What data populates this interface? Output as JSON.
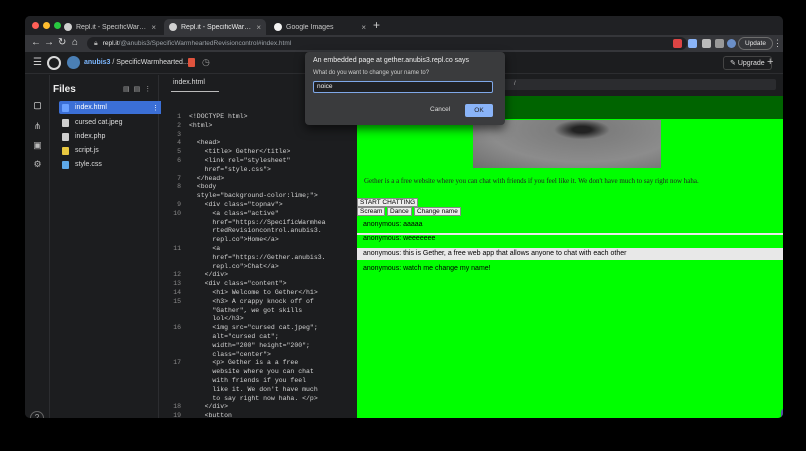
{
  "browser": {
    "tabs": [
      {
        "title": "Repl.it - SpecificWarmhearted",
        "close": "×"
      },
      {
        "title": "Repl.it - SpecificWarmhearted",
        "close": "×"
      },
      {
        "title": "Google Images",
        "close": "×"
      }
    ],
    "new_tab": "+",
    "url_host": "repl.it",
    "url_path": "/@anubis3/SpecificWarmheartedRevisioncontrol#index.html",
    "update_label": "Update"
  },
  "replit": {
    "user": "anubis3",
    "separator": " / ",
    "project": "SpecificWarmhearted...",
    "upgrade_label": "Upgrade",
    "plus": "+"
  },
  "files": {
    "title": "Files",
    "items": [
      {
        "name": "index.html",
        "icon": "html-file-icon",
        "color": "#6aa0ff"
      },
      {
        "name": "cursed cat.jpeg",
        "icon": "file-icon",
        "color": "#cfcfcf"
      },
      {
        "name": "index.php",
        "icon": "file-icon",
        "color": "#cfcfcf"
      },
      {
        "name": "script.js",
        "icon": "js-file-icon",
        "color": "#e8c840"
      },
      {
        "name": "style.css",
        "icon": "css-file-icon",
        "color": "#5ea8e8"
      }
    ],
    "help": "?"
  },
  "editor": {
    "tab": "index.html",
    "lines": [
      {
        "n": "1",
        "text": "<!DOCTYPE html>"
      },
      {
        "n": "2",
        "text": "<html>"
      },
      {
        "n": "3",
        "text": ""
      },
      {
        "n": "4",
        "text": "  <head>"
      },
      {
        "n": "5",
        "text": "    <title> Gether</title>"
      },
      {
        "n": "6",
        "text": "    <link rel=\"stylesheet\""
      },
      {
        "n": "",
        "text": "    href=\"style.css\">"
      },
      {
        "n": "7",
        "text": "  </head>"
      },
      {
        "n": "8",
        "text": "  <body"
      },
      {
        "n": "",
        "text": "  style=\"background-color:lime;\">"
      },
      {
        "n": "9",
        "text": "    <div class=\"topnav\">"
      },
      {
        "n": "10",
        "text": "      <a class=\"active\""
      },
      {
        "n": "",
        "text": "      href=\"https://SpecificWarmhea"
      },
      {
        "n": "",
        "text": "      rtedRevisioncontrol.anubis3."
      },
      {
        "n": "",
        "text": "      repl.co\">Home</a>"
      },
      {
        "n": "11",
        "text": "      <a"
      },
      {
        "n": "",
        "text": "      href=\"https://Gether.anubis3."
      },
      {
        "n": "",
        "text": "      repl.co\">Chat</a>"
      },
      {
        "n": "12",
        "text": "    </div>"
      },
      {
        "n": "13",
        "text": "    <div class=\"content\">"
      },
      {
        "n": "14",
        "text": "      <h1> Welcome to Gether</h1>"
      },
      {
        "n": "15",
        "text": "      <h3> A crappy knock off of"
      },
      {
        "n": "",
        "text": "      \"Gather\", we got skills"
      },
      {
        "n": "",
        "text": "      lol</h3>"
      },
      {
        "n": "16",
        "text": "      <img src=\"cursed cat.jpeg\";"
      },
      {
        "n": "",
        "text": "      alt=\"cursed cat\";"
      },
      {
        "n": "",
        "text": "      width=\"200\" height=\"200\";"
      },
      {
        "n": "",
        "text": "      class=\"center\">"
      },
      {
        "n": "17",
        "text": "      <p> Gether is a a free"
      },
      {
        "n": "",
        "text": "      website where you can chat"
      },
      {
        "n": "",
        "text": "      with friends if you feel"
      },
      {
        "n": "",
        "text": "      like it. We don't have much"
      },
      {
        "n": "",
        "text": "      to say right now haha. </p>"
      },
      {
        "n": "18",
        "text": "    </div>"
      },
      {
        "n": "19",
        "text": "    <button"
      }
    ]
  },
  "preview": {
    "url_fragment": "/",
    "blurb": "Gether is a a free website where you can chat with friends if you feel like it. We don't have much to say right now haha.",
    "start_button": "START CHATTING",
    "buttons": [
      "Scream",
      "Dance",
      "Change name"
    ],
    "messages": [
      "anonymous: aaaaa",
      "anonymous: weeeeeee",
      "anonymous: this is Gether, a free web app that allows anyone to chat with each other",
      "anonymous: watch me change my name!"
    ],
    "page_bg": "#00ff00",
    "nav_bg": "#006400"
  },
  "dialog": {
    "title": "An embedded page at gether.anubis3.repl.co says",
    "prompt": "What do you want to change your name to?",
    "value": "noice",
    "cancel": "Cancel",
    "ok": "OK"
  }
}
